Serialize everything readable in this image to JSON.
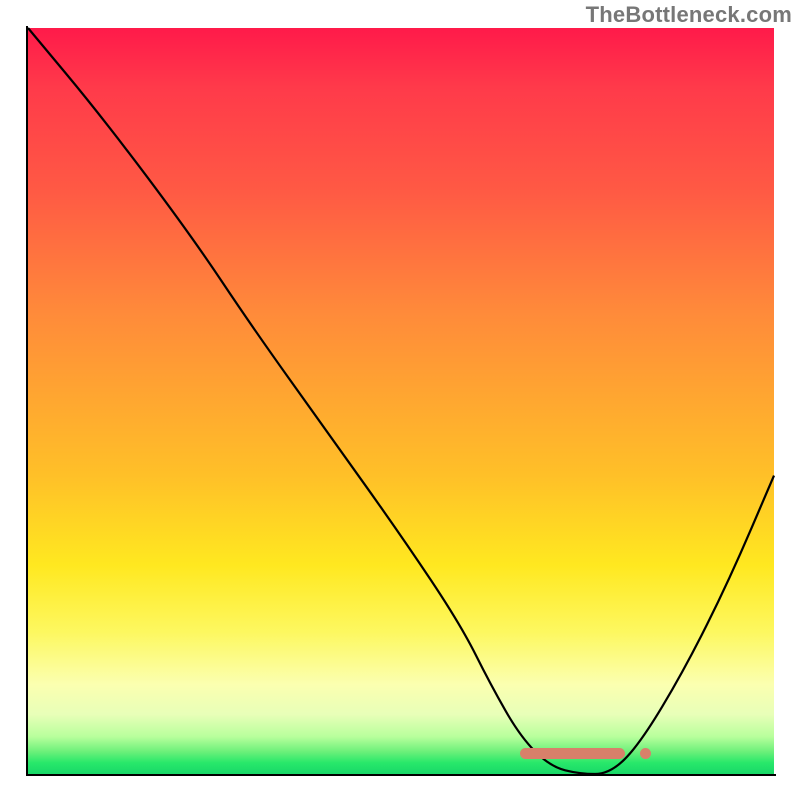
{
  "watermark": "TheBottleneck.com",
  "chart_data": {
    "type": "line",
    "title": "",
    "xlabel": "",
    "ylabel": "",
    "xlim": [
      0,
      100
    ],
    "ylim": [
      0,
      100
    ],
    "grid": false,
    "background": "rainbow-gradient-vertical",
    "series": [
      {
        "name": "bottleneck-curve",
        "color": "#000000",
        "x": [
          0,
          10,
          22,
          30,
          40,
          50,
          58,
          62,
          66,
          70,
          74,
          78,
          82,
          88,
          94,
          100
        ],
        "values": [
          100,
          88,
          72,
          60,
          46,
          32,
          20,
          12,
          5,
          1,
          0,
          0,
          4,
          14,
          26,
          40
        ]
      }
    ],
    "marker": {
      "x_start": 66,
      "x_end": 80,
      "y": 0,
      "extra_dot_x": 82
    },
    "gradient_stops": [
      {
        "pos": 0,
        "color": "#ff1a4a"
      },
      {
        "pos": 0.22,
        "color": "#ff5a44"
      },
      {
        "pos": 0.6,
        "color": "#ffc028"
      },
      {
        "pos": 0.88,
        "color": "#fbffb0"
      },
      {
        "pos": 1.0,
        "color": "#18d868"
      }
    ]
  }
}
